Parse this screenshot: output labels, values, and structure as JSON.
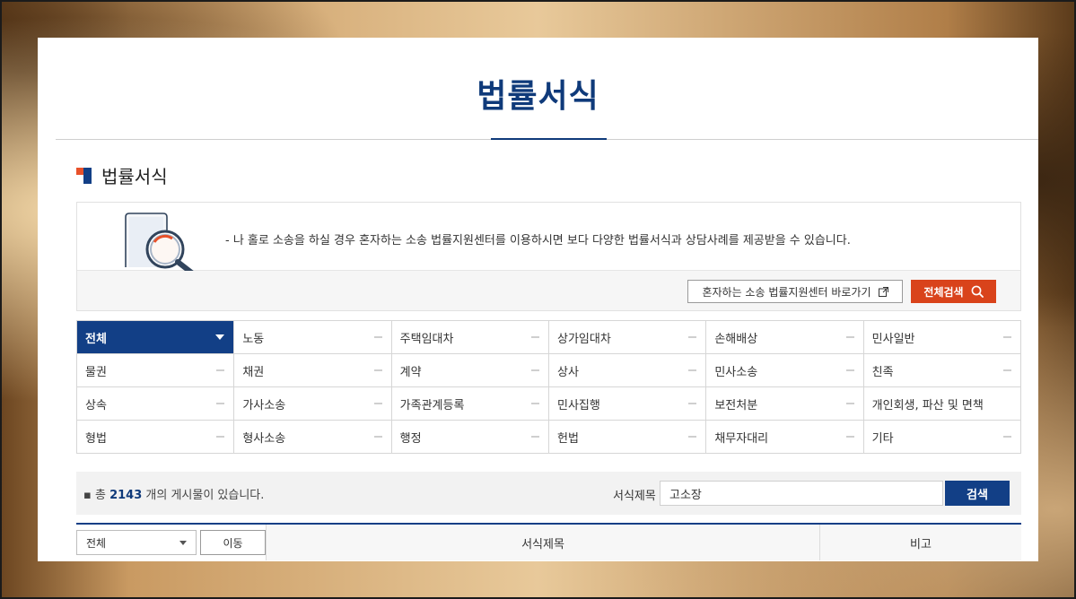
{
  "page": {
    "title": "법률서식",
    "section_title": "법률서식"
  },
  "notice": {
    "text": "- 나 홀로 소송을 하실 경우 혼자하는 소송 법률지원센터를 이용하시면 보다 다양한 법률서식과 상담사례를 제공받을 수 있습니다.",
    "center_link_label": "혼자하는 소송 법률지원센터 바로가기",
    "center_link_icon": "external-link-icon",
    "all_search_label": "전체검색",
    "all_search_icon": "search-icon"
  },
  "categories": [
    {
      "label": "전체",
      "active": true
    },
    {
      "label": "노동"
    },
    {
      "label": "주택임대차"
    },
    {
      "label": "상가임대차"
    },
    {
      "label": "손해배상"
    },
    {
      "label": "민사일반"
    },
    {
      "label": "물권"
    },
    {
      "label": "채권"
    },
    {
      "label": "계약"
    },
    {
      "label": "상사"
    },
    {
      "label": "민사소송"
    },
    {
      "label": "친족"
    },
    {
      "label": "상속"
    },
    {
      "label": "가사소송"
    },
    {
      "label": "가족관계등록"
    },
    {
      "label": "민사집행"
    },
    {
      "label": "보전처분"
    },
    {
      "label": "개인회생, 파산 및 면책"
    },
    {
      "label": "형법"
    },
    {
      "label": "형사소송"
    },
    {
      "label": "행정"
    },
    {
      "label": "헌법"
    },
    {
      "label": "채무자대리"
    },
    {
      "label": "기타"
    }
  ],
  "search": {
    "total_prefix": "총",
    "total_count": "2143",
    "total_suffix": "개의 게시물이 있습니다.",
    "label": "서식제목",
    "value": "고소장",
    "button": "검색"
  },
  "table": {
    "select_value": "전체",
    "move_button": "이동",
    "col_title": "서식제목",
    "col_note": "비고"
  },
  "colors": {
    "primary": "#123f86",
    "accent": "#d9431b",
    "title": "#0f3a7a"
  }
}
